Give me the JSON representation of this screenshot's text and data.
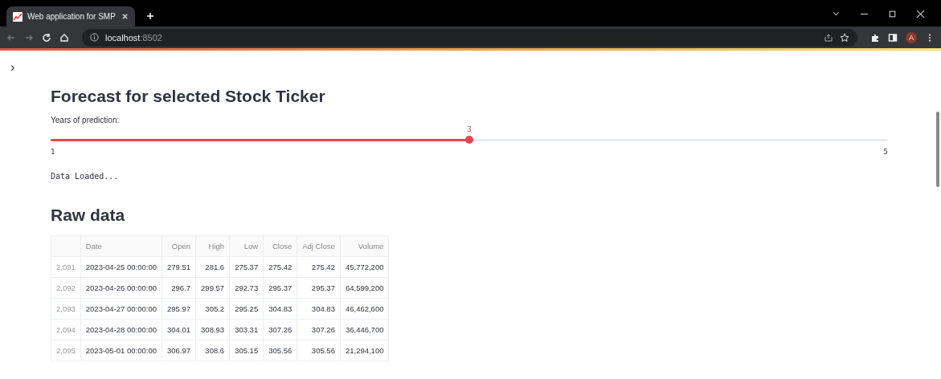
{
  "browser": {
    "tab_title": "Web application for SMP",
    "address_host": "localhost",
    "address_port": ":8502",
    "profile_initial": "A"
  },
  "sidebar_toggle": "›",
  "title": "Forecast for selected Stock Ticker",
  "slider": {
    "label": "Years of prediction:",
    "value": "3",
    "min": "1",
    "max": "5",
    "level": 0.5
  },
  "status": "Data Loaded...",
  "raw_title": "Raw data",
  "table": {
    "columns": [
      "Date",
      "Open",
      "High",
      "Low",
      "Close",
      "Adj Close",
      "Volume"
    ],
    "rows": [
      {
        "index": "2,091",
        "cells": [
          "2023-04-25 00:00:00",
          "279.51",
          "281.6",
          "275.37",
          "275.42",
          "275.42",
          "45,772,200"
        ]
      },
      {
        "index": "2,092",
        "cells": [
          "2023-04-26 00:00:00",
          "296.7",
          "299.57",
          "292.73",
          "295.37",
          "295.37",
          "64,599,200"
        ]
      },
      {
        "index": "2,093",
        "cells": [
          "2023-04-27 00:00:00",
          "295.97",
          "305.2",
          "295.25",
          "304.83",
          "304.83",
          "46,462,600"
        ]
      },
      {
        "index": "2,094",
        "cells": [
          "2023-04-28 00:00:00",
          "304.01",
          "308.93",
          "303.31",
          "307.26",
          "307.26",
          "36,446,700"
        ]
      },
      {
        "index": "2,095",
        "cells": [
          "2023-05-01 00:00:00",
          "306.97",
          "308.6",
          "305.15",
          "305.56",
          "305.56",
          "21,294,100"
        ]
      }
    ]
  }
}
